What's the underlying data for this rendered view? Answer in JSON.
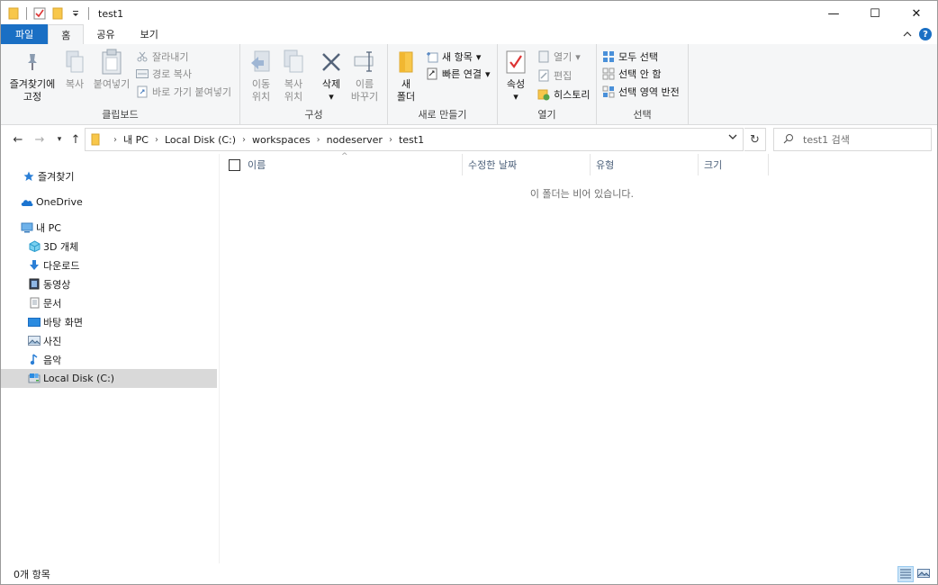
{
  "window": {
    "title": "test1"
  },
  "title_controls": {
    "minimize": "—",
    "maximize": "☐",
    "close": "✕"
  },
  "ribbon_tabs": [
    {
      "label": "파일"
    },
    {
      "label": "홈"
    },
    {
      "label": "공유"
    },
    {
      "label": "보기"
    }
  ],
  "ribbon": {
    "clipboard": {
      "label": "클립보드",
      "pin_line1": "즐겨찾기에",
      "pin_line2": "고정",
      "copy": "복사",
      "paste": "붙여넣기",
      "cut": "잘라내기",
      "copy_path": "경로 복사",
      "paste_shortcut": "바로 가기 붙여넣기"
    },
    "organize": {
      "label": "구성",
      "move_line1": "이동",
      "move_line2": "위치",
      "copyto_line1": "복사",
      "copyto_line2": "위치",
      "delete": "삭제",
      "rename_line1": "이름",
      "rename_line2": "바꾸기"
    },
    "new": {
      "label": "새로 만들기",
      "folder_line1": "새",
      "folder_line2": "폴더",
      "new_item": "새 항목",
      "easy_access": "빠른 연결"
    },
    "open": {
      "label": "열기",
      "properties": "속성",
      "open": "열기",
      "edit": "편집",
      "history": "히스토리"
    },
    "select": {
      "label": "선택",
      "select_all": "모두 선택",
      "select_none": "선택 안 함",
      "invert": "선택 영역 반전"
    }
  },
  "address": {
    "breadcrumbs": [
      "내 PC",
      "Local Disk (C:)",
      "workspaces",
      "nodeserver",
      "test1"
    ],
    "search_placeholder": "test1 검색"
  },
  "nav_pane": {
    "items": [
      {
        "label": "즐겨찾기",
        "icon": "star-icon"
      },
      {
        "label": "OneDrive",
        "icon": "cloud-icon"
      },
      {
        "label": "내 PC",
        "icon": "computer-icon"
      },
      {
        "label": "3D 개체",
        "icon": "cube-icon"
      },
      {
        "label": "다운로드",
        "icon": "download-icon"
      },
      {
        "label": "동영상",
        "icon": "video-icon"
      },
      {
        "label": "문서",
        "icon": "document-icon"
      },
      {
        "label": "바탕 화면",
        "icon": "desktop-icon"
      },
      {
        "label": "사진",
        "icon": "pictures-icon"
      },
      {
        "label": "음악",
        "icon": "music-icon"
      },
      {
        "label": "Local Disk (C:)",
        "icon": "drive-icon",
        "selected": true
      }
    ]
  },
  "content": {
    "columns": [
      "이름",
      "수정한 날짜",
      "유형",
      "크기"
    ],
    "empty_message": "이 폴더는 비어 있습니다."
  },
  "status": {
    "item_count": "0개 항목"
  },
  "colors": {
    "accent": "#1a6fc4",
    "folder": "#f8c74a",
    "selected": "#d9d9d9"
  }
}
